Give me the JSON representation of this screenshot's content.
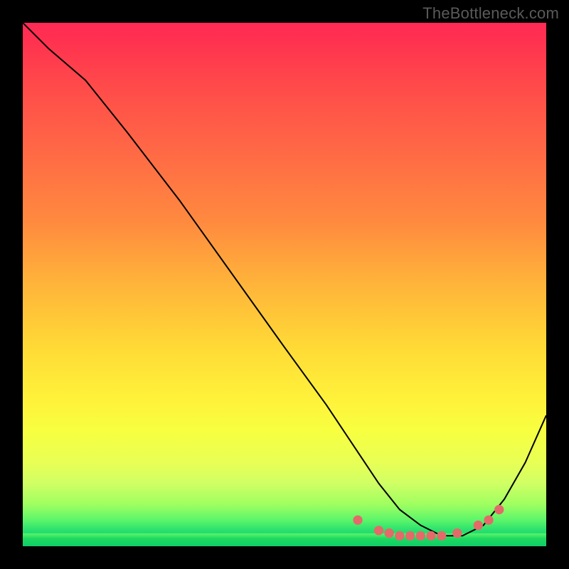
{
  "watermark": "TheBottleneck.com",
  "chart_data": {
    "type": "line",
    "title": "",
    "xlabel": "",
    "ylabel": "",
    "xlim": [
      0,
      100
    ],
    "ylim": [
      0,
      100
    ],
    "grid": false,
    "legend": false,
    "series": [
      {
        "name": "curve",
        "x": [
          0,
          5,
          12,
          20,
          30,
          40,
          50,
          58,
          64,
          68,
          72,
          76,
          80,
          84,
          88,
          92,
          96,
          100
        ],
        "values": [
          100,
          95,
          89,
          79,
          66,
          52,
          38,
          27,
          18,
          12,
          7,
          4,
          2,
          2,
          4,
          9,
          16,
          25
        ]
      }
    ],
    "markers": {
      "name": "bottom-cluster",
      "color": "#e46a6a",
      "x": [
        64,
        68,
        70,
        72,
        74,
        76,
        78,
        80,
        83,
        87,
        89,
        91
      ],
      "values": [
        5,
        3,
        2.5,
        2,
        2,
        2,
        2,
        2,
        2.5,
        4,
        5,
        7
      ]
    }
  }
}
